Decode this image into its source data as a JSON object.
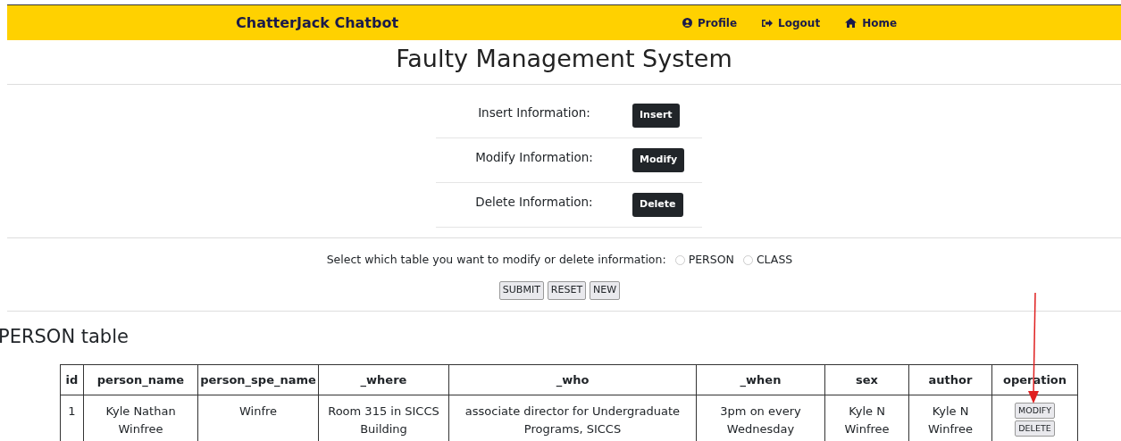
{
  "navbar": {
    "brand": "ChatterJack Chatbot",
    "links": [
      {
        "label": "Profile"
      },
      {
        "label": "Logout"
      },
      {
        "label": "Home"
      }
    ]
  },
  "title": "Faulty Management System",
  "actions": [
    {
      "label": "Insert Information:",
      "button": "Insert"
    },
    {
      "label": "Modify Information:",
      "button": "Modify"
    },
    {
      "label": "Delete Information:",
      "button": "Delete"
    }
  ],
  "table_select": {
    "prompt": "Select which table you want to modify or delete information:",
    "options": [
      {
        "label": "PERSON",
        "selected": false
      },
      {
        "label": "CLASS",
        "selected": false
      }
    ],
    "buttons": [
      "SUBMIT",
      "RESET",
      "NEW"
    ]
  },
  "section_title": "PERSON table",
  "table": {
    "columns": [
      "id",
      "person_name",
      "person_spe_name",
      "_where",
      "_who",
      "_when",
      "sex",
      "author",
      "operation"
    ],
    "rows": [
      {
        "cells": [
          "1",
          "Kyle Nathan Winfree",
          "Winfre",
          "Room 315 in SICCS Building",
          "associate director for Undergraduate Programs, SICCS",
          "3pm on every Wednesday",
          "Kyle N Winfree",
          "Kyle N Winfree"
        ],
        "operations": [
          "MODIFY",
          "DELETE"
        ]
      }
    ]
  }
}
